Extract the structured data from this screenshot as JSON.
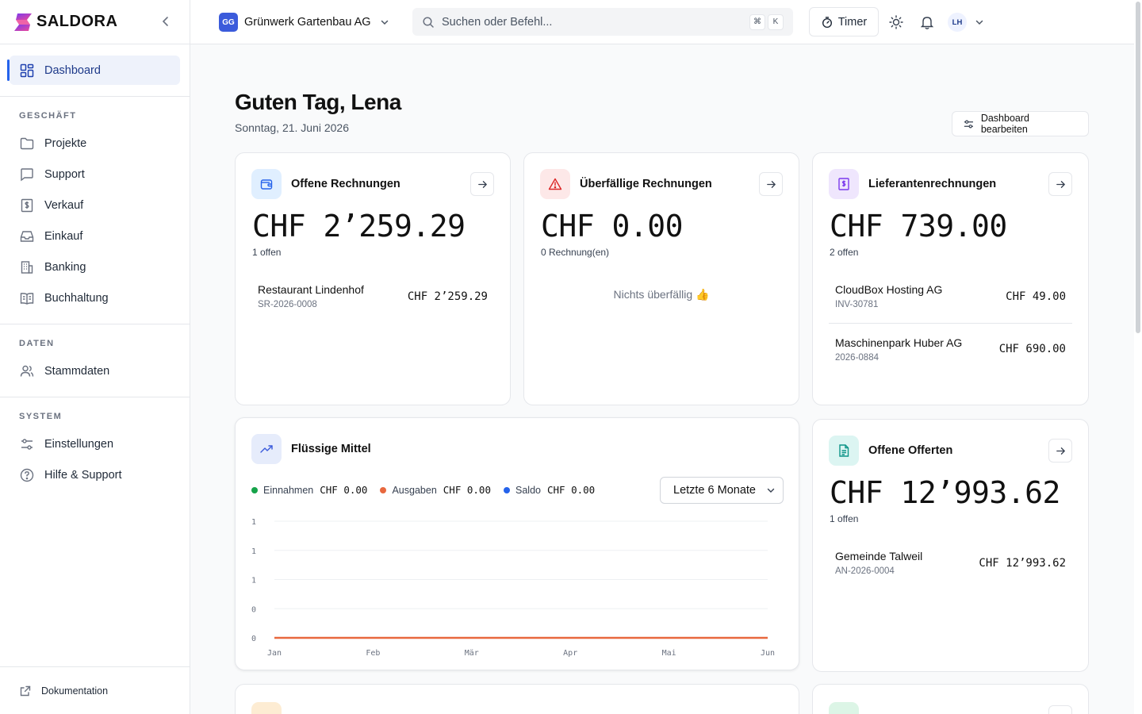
{
  "brand": {
    "name": "SALDORA",
    "gradient_colors": [
      "#7c3aed",
      "#ec4899"
    ]
  },
  "sidebar": {
    "dashboard": "Dashboard",
    "sections": [
      {
        "heading": "GESCHÄFT",
        "items": [
          "Projekte",
          "Support",
          "Verkauf",
          "Einkauf",
          "Banking",
          "Buchhaltung"
        ]
      },
      {
        "heading": "DATEN",
        "items": [
          "Stammdaten"
        ]
      },
      {
        "heading": "SYSTEM",
        "items": [
          "Einstellungen",
          "Hilfe & Support"
        ]
      }
    ],
    "doc_link": "Dokumentation"
  },
  "header": {
    "company_initials": "GG",
    "company_name": "Grünwerk Gartenbau AG",
    "search_placeholder": "Suchen oder Befehl...",
    "kbd_cmd": "⌘",
    "kbd_k": "K",
    "timer_label": "Timer",
    "user_initials": "LH"
  },
  "main": {
    "greeting": "Guten Tag, Lena",
    "date": "Sonntag, 21. Juni 2026",
    "edit_button": "Dashboard bearbeiten"
  },
  "cards": {
    "open_invoices": {
      "title": "Offene Rechnungen",
      "amount": "CHF 2’259.29",
      "subtitle": "1 offen",
      "rows": [
        {
          "name": "Restaurant Lindenhof",
          "ref": "SR-2026-0008",
          "amount": "CHF 2’259.29"
        }
      ]
    },
    "overdue_invoices": {
      "title": "Überfällige Rechnungen",
      "amount": "CHF 0.00",
      "subtitle": "0 Rechnung(en)",
      "empty_text": "Nichts überfällig 👍"
    },
    "supplier_invoices": {
      "title": "Lieferantenrechnungen",
      "amount": "CHF 739.00",
      "subtitle": "2 offen",
      "rows": [
        {
          "name": "CloudBox Hosting AG",
          "ref": "INV-30781",
          "amount": "CHF 49.00"
        },
        {
          "name": "Maschinenpark Huber AG",
          "ref": "2026-0884",
          "amount": "CHF 690.00"
        }
      ]
    },
    "liquidity": {
      "title": "Flüssige Mittel",
      "legend": [
        {
          "label": "Einnahmen",
          "value": "CHF 0.00",
          "color": "#16a34a"
        },
        {
          "label": "Ausgaben",
          "value": "CHF 0.00",
          "color": "#e8683e"
        },
        {
          "label": "Saldo",
          "value": "CHF 0.00",
          "color": "#2563eb"
        }
      ],
      "period": "Letzte 6 Monate"
    },
    "open_offers": {
      "title": "Offene Offerten",
      "amount": "CHF 12’993.62",
      "subtitle": "1 offen",
      "rows": [
        {
          "name": "Gemeinde Talweil",
          "ref": "AN-2026-0004",
          "amount": "CHF 12’993.62"
        }
      ]
    }
  },
  "chart_data": {
    "type": "line",
    "categories": [
      "Jan",
      "Feb",
      "Mär",
      "Apr",
      "Mai",
      "Jun"
    ],
    "y_tick_labels": [
      "1",
      "1",
      "1",
      "0",
      "0"
    ],
    "series": [
      {
        "name": "Einnahmen",
        "values": [
          0,
          0,
          0,
          0,
          0,
          0
        ],
        "color": "#16a34a"
      },
      {
        "name": "Ausgaben",
        "values": [
          0,
          0,
          0,
          0,
          0,
          0
        ],
        "color": "#e8683e"
      },
      {
        "name": "Saldo",
        "values": [
          0,
          0,
          0,
          0,
          0,
          0
        ],
        "color": "#2563eb"
      }
    ],
    "ylim": [
      0,
      1
    ],
    "grid": true
  }
}
